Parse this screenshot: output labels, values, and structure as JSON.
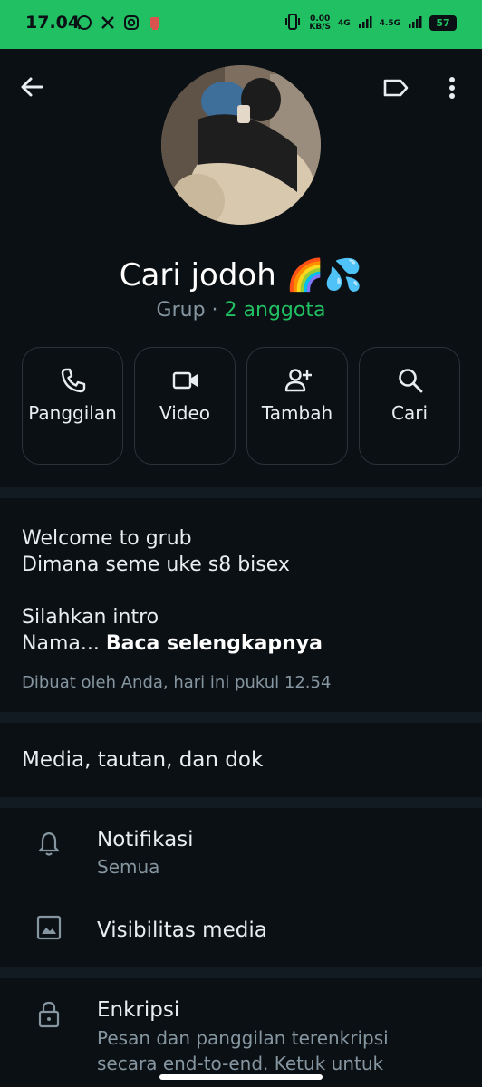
{
  "status_bar": {
    "time": "17.04",
    "left_icons": [
      "whatsapp-icon",
      "x-icon",
      "instagram-icon",
      "notification-app-icon"
    ],
    "speed_value": "0.00",
    "speed_unit": "KB/S",
    "net_1": "4G",
    "net_2": "4.5G",
    "battery": "57"
  },
  "header": {
    "group_name": "Cari jodoh 🌈💦",
    "group_type": "Grup",
    "separator": " · ",
    "members": "2 anggota"
  },
  "actions": [
    {
      "label": "Panggilan",
      "icon": "phone-icon"
    },
    {
      "label": "Video",
      "icon": "video-icon"
    },
    {
      "label": "Tambah",
      "icon": "add-person-icon"
    },
    {
      "label": "Cari",
      "icon": "search-icon"
    }
  ],
  "description": {
    "line1": "Welcome to grub",
    "line2": "Dimana seme uke s8 bisex",
    "line3": "Silahkan intro",
    "line4": "Nama...",
    "read_more": "Baca selengkapnya",
    "created": "Dibuat oleh Anda, hari ini pukul 12.54"
  },
  "media": {
    "label": "Media, tautan, dan dok"
  },
  "settings": {
    "notifications_title": "Notifikasi",
    "notifications_value": "Semua",
    "media_visibility_title": "Visibilitas media"
  },
  "encryption": {
    "title": "Enkripsi",
    "subtitle": "Pesan dan panggilan terenkripsi secara end-to-end. Ketuk untuk"
  },
  "colors": {
    "accent": "#21c063",
    "background": "#0b1014",
    "separator": "#111b21",
    "secondary_text": "#8696a0"
  }
}
